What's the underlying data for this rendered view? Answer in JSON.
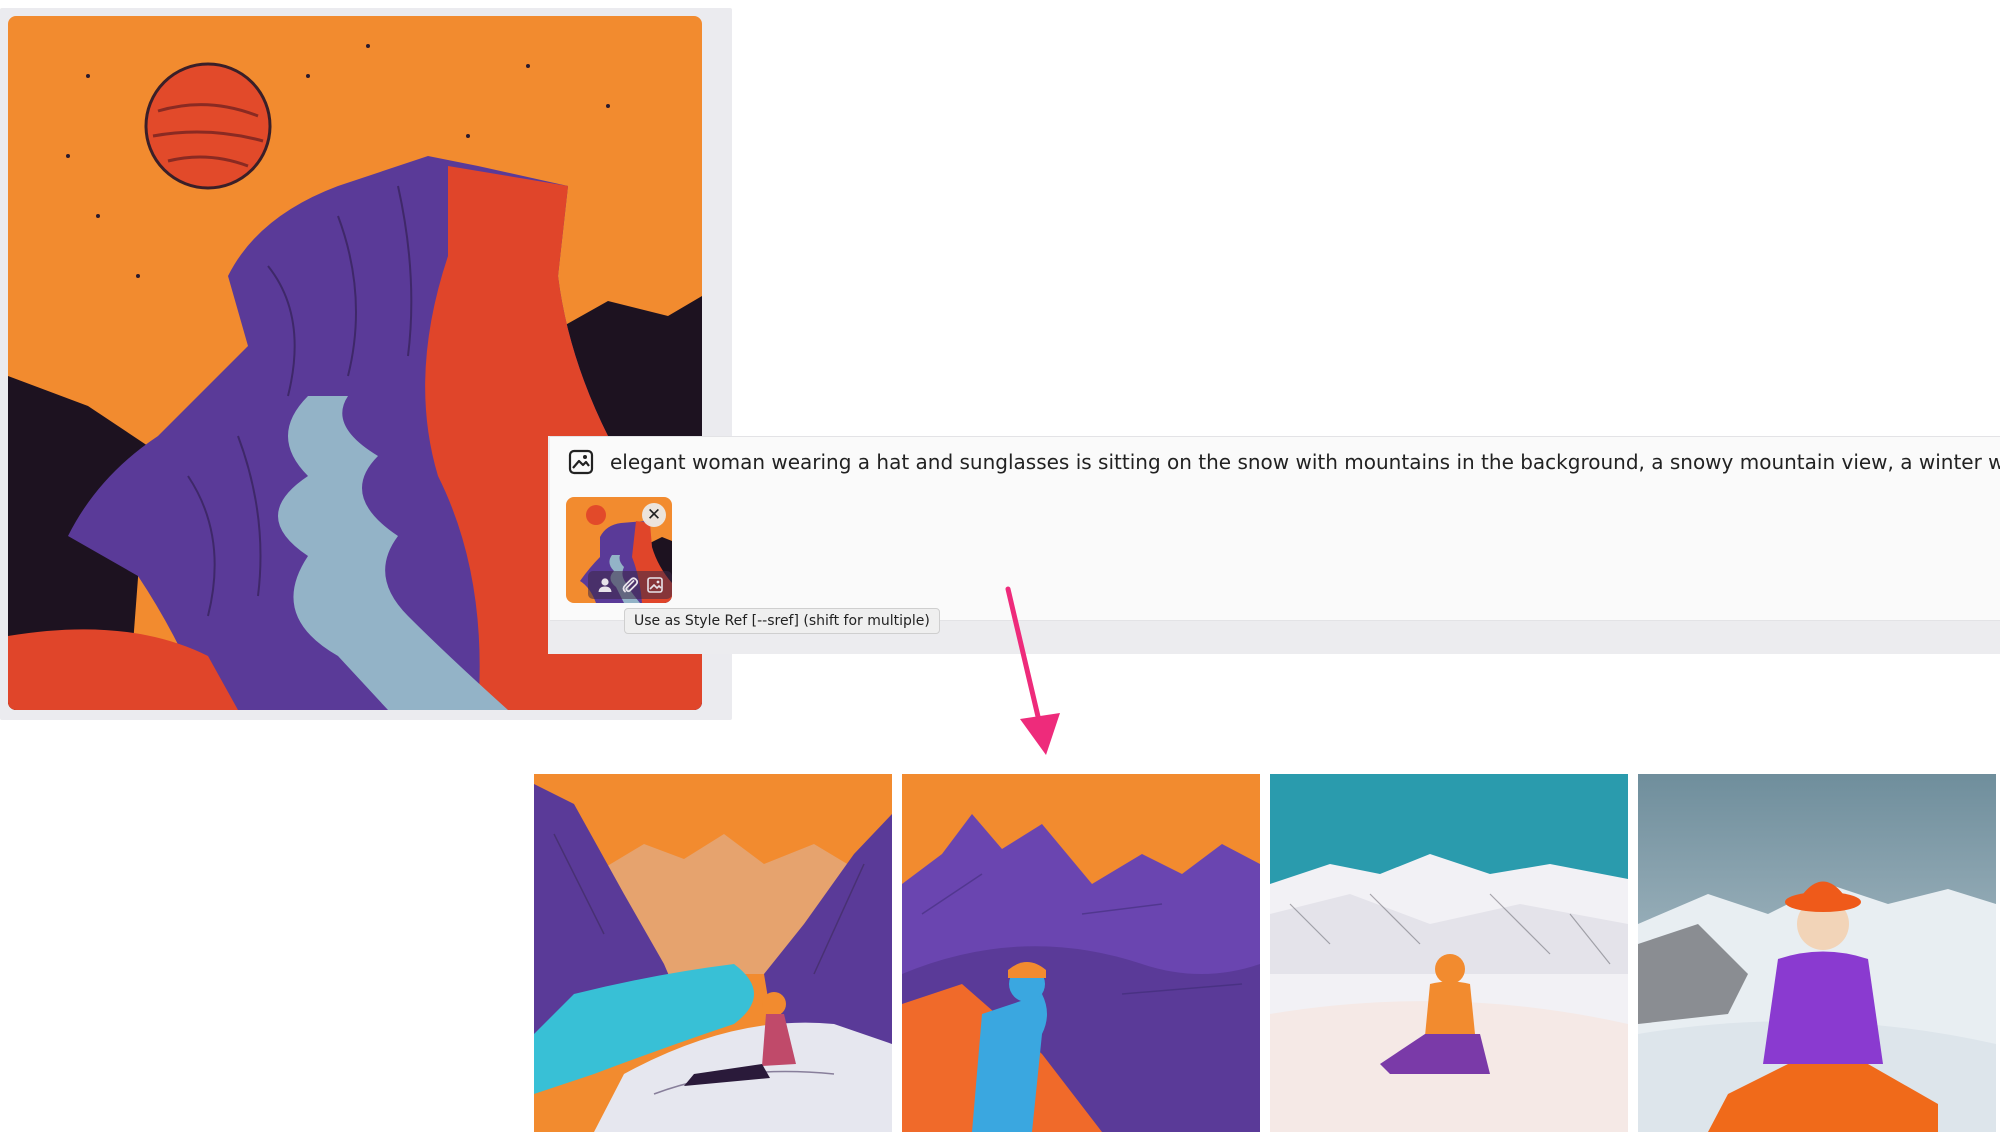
{
  "prompt": {
    "icon": "image-icon",
    "text": "elegant woman wearing a hat and sunglasses is sitting on the snow with mountains in the background, a snowy mountain view, a winter wonderland"
  },
  "attachment": {
    "thumbnail": "style-reference-image",
    "close_glyph": "✕",
    "actions": [
      "person-icon",
      "paperclip-icon",
      "image-style-icon"
    ],
    "tooltip": "Use as Style Ref [--sref] (shift for multiple)"
  },
  "results": [
    {
      "name": "result-image-1"
    },
    {
      "name": "result-image-2"
    },
    {
      "name": "result-image-3"
    },
    {
      "name": "result-image-4"
    }
  ],
  "colors": {
    "accent_arrow": "#ee2b7b",
    "orange": "#f08a2e",
    "purple": "#5b3a9a",
    "teal": "#2a9bad"
  }
}
